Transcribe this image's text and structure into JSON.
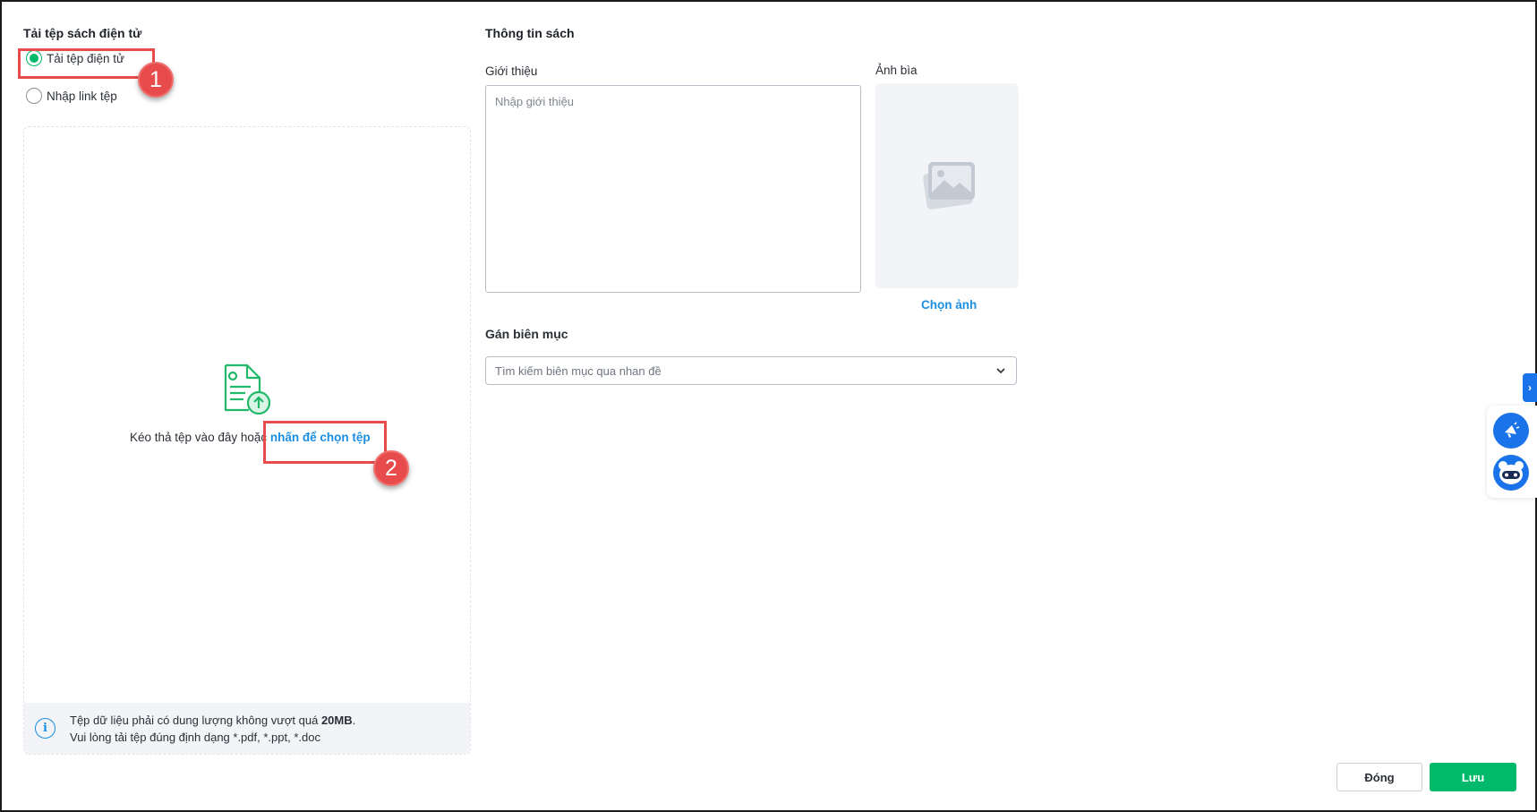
{
  "left": {
    "title": "Tải tệp sách điện tử",
    "radio_options": [
      {
        "label": "Tải tệp điện tử",
        "checked": true
      },
      {
        "label": "Nhập link tệp",
        "checked": false
      }
    ],
    "dropzone": {
      "text": "Kéo thả tệp vào đây hoặc",
      "link": "nhấn để chọn tệp"
    },
    "info": {
      "line1_prefix": "Tệp dữ liệu phải có dung lượng không vượt quá ",
      "line1_bold": "20MB",
      "line1_suffix": ".",
      "line2": "Vui lòng tải tệp đúng định dạng *.pdf, *.ppt, *.doc"
    }
  },
  "right": {
    "title": "Thông tin sách",
    "intro_label": "Giới thiệu",
    "intro_placeholder": "Nhập giới thiệu",
    "cover_label": "Ảnh bìa",
    "choose_image": "Chọn ảnh",
    "catalog_label": "Gán biên mục",
    "catalog_placeholder": "Tìm kiếm biên mục qua nhan đề"
  },
  "annotations": {
    "step1": "1",
    "step2": "2"
  },
  "footer": {
    "close_label": "Đóng",
    "save_label": "Lưu"
  },
  "side_tab_glyph": "›",
  "colors": {
    "primary_green": "#00b96b",
    "link_blue": "#1a8fe3",
    "highlight_red": "#e84b4b",
    "widget_blue": "#1a73e8"
  },
  "icons": [
    "upload-file-icon",
    "info-icon",
    "image-placeholder-icon",
    "chevron-down-icon",
    "megaphone-icon",
    "chatbot-icon"
  ]
}
